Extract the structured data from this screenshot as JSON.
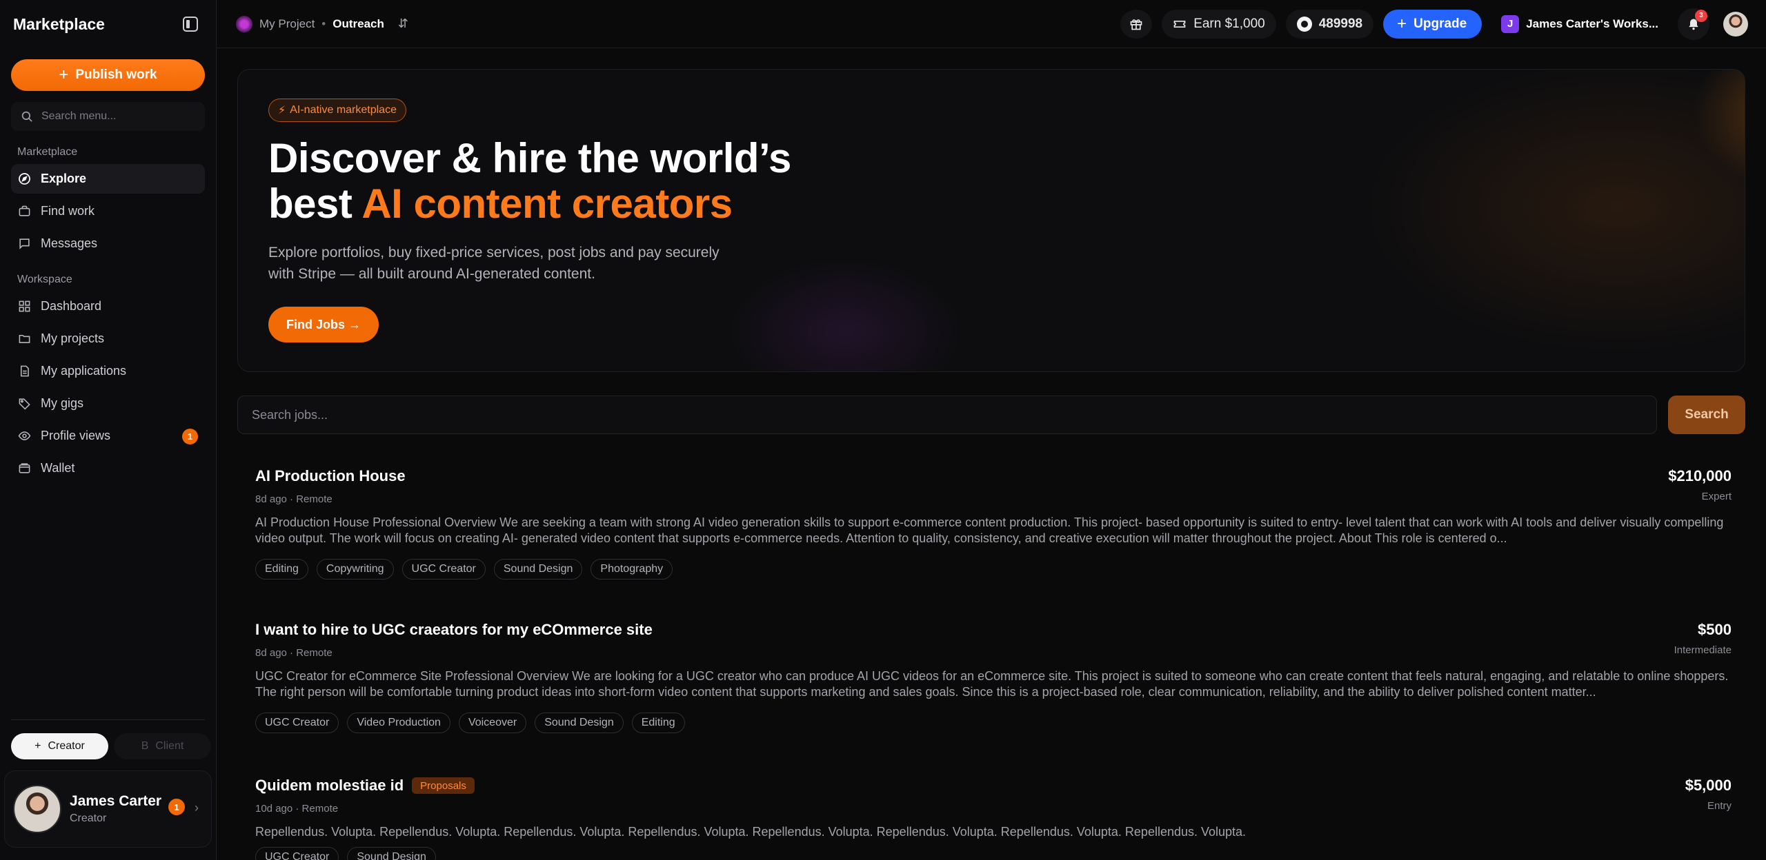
{
  "sidebar": {
    "title": "Marketplace",
    "publish_label": "Publish work",
    "search_placeholder": "Search menu...",
    "section_marketplace": "Marketplace",
    "section_workspace": "Workspace",
    "items": [
      {
        "label": "Explore",
        "icon": "compass-icon"
      },
      {
        "label": "Find work",
        "icon": "briefcase-icon"
      },
      {
        "label": "Messages",
        "icon": "message-icon"
      },
      {
        "label": "Dashboard",
        "icon": "grid-icon"
      },
      {
        "label": "My projects",
        "icon": "folder-icon"
      },
      {
        "label": "My applications",
        "icon": "document-icon"
      },
      {
        "label": "My gigs",
        "icon": "tag-icon"
      },
      {
        "label": "Profile views",
        "icon": "eye-icon",
        "badge": "1"
      },
      {
        "label": "Wallet",
        "icon": "wallet-icon"
      }
    ],
    "roles": {
      "creator": "Creator",
      "client": "Client",
      "client_initial": "B"
    },
    "user": {
      "name": "James Carter",
      "role": "Creator",
      "badge": "1"
    }
  },
  "topbar": {
    "project": "My Project",
    "page": "Outreach",
    "earn_label": "Earn $1,000",
    "credits": "489998",
    "upgrade_label": "Upgrade",
    "workspace_initial": "J",
    "workspace_name": "James Carter's Works...",
    "notification_count": "3"
  },
  "hero": {
    "tag": "AI-native marketplace",
    "title_line1": "Discover & hire the world’s",
    "title_line2_prefix": "best ",
    "title_line2_accent": "AI content creators",
    "subtitle_line1": "Explore portfolios, buy fixed-price services, post jobs and pay securely",
    "subtitle_line2": "with Stripe — all built around AI-generated content.",
    "cta_label": "Find Jobs →"
  },
  "job_search": {
    "placeholder": "Search jobs...",
    "button_label": "Search"
  },
  "jobs": [
    {
      "title": "AI Production House",
      "meta": "8d ago · Remote",
      "price": "$210,000",
      "level": "Expert",
      "description": "AI Production House Professional Overview We are seeking a team with strong AI video generation skills to support e-commerce content production. This project- based opportunity is suited to entry- level talent that can work with AI tools and deliver visually compelling video output. The work will focus on creating AI- generated video content that supports e-commerce needs. Attention to quality, consistency, and creative execution will matter throughout the project. About This role is centered o...",
      "tags": [
        "Editing",
        "Copywriting",
        "UGC Creator",
        "Sound Design",
        "Photography"
      ]
    },
    {
      "title": "I want to hire to UGC craeators for my eCOmmerce site",
      "meta": "8d ago · Remote",
      "price": "$500",
      "level": "Intermediate",
      "description": "UGC Creator for eCommerce Site Professional Overview We are looking for a UGC creator who can produce AI UGC videos for an eCommerce site. This project is suited to someone who can create content that feels natural, engaging, and relatable to online shoppers. The right person will be comfortable turning product ideas into short-form video content that supports marketing and sales goals. Since this is a project-based role, clear communication, reliability, and the ability to deliver polished content matter...",
      "tags": [
        "UGC Creator",
        "Video Production",
        "Voiceover",
        "Sound Design",
        "Editing"
      ]
    },
    {
      "title": "Quidem molestiae id",
      "proposals": "Proposals",
      "meta": "10d ago · Remote",
      "price": "$5,000",
      "level": "Entry",
      "description": "Repellendus. Volupta. Repellendus. Volupta. Repellendus. Volupta. Repellendus. Volupta. Repellendus. Volupta. Repellendus. Volupta. Repellendus. Volupta. Repellendus. Volupta.",
      "tags": [
        "UGC Creator",
        "Sound Design"
      ]
    }
  ],
  "colors": {
    "accent": "#f26a05",
    "upgrade": "#2563ff",
    "workspace": "#7c3aed"
  }
}
